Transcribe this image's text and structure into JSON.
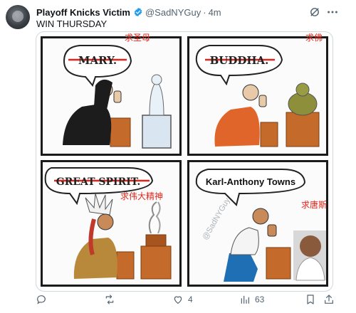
{
  "tweet": {
    "display_name": "Playoff Knicks Victim",
    "handle": "@SadNYGuy",
    "separator": "·",
    "time": "4m",
    "text": "WIN THURSDAY",
    "icons": {
      "verified": "verified-badge-icon",
      "grok": "grok-icon",
      "more": "more-icon",
      "avatar": "avatar"
    }
  },
  "meme": {
    "panels": [
      {
        "sign": "MARY.",
        "caption": "求圣母",
        "figure": "nun praying to statue"
      },
      {
        "sign": "BUDDHA.",
        "caption": "求佛",
        "figure": "monk praying to buddha"
      },
      {
        "sign": "GREAT SPIRIT.",
        "caption": "求伟大精神",
        "figure": "chief praying to fire"
      },
      {
        "sign": "Karl-Anthony Towns",
        "caption": "求唐斯",
        "figure": "man praying to player"
      }
    ],
    "watermark": "@SadNYGuy"
  },
  "actions": {
    "reply": {
      "icon": "reply-icon",
      "count": ""
    },
    "retweet": {
      "icon": "retweet-icon",
      "count": ""
    },
    "like": {
      "icon": "like-icon",
      "count": "4"
    },
    "views": {
      "icon": "views-icon",
      "count": "63"
    },
    "bookmark": {
      "icon": "bookmark-icon",
      "count": ""
    },
    "share": {
      "icon": "share-icon",
      "count": ""
    }
  },
  "colors": {
    "text": "#0f1419",
    "muted": "#536471",
    "verified": "#1d9bf0",
    "caption_red": "#e0261a"
  }
}
